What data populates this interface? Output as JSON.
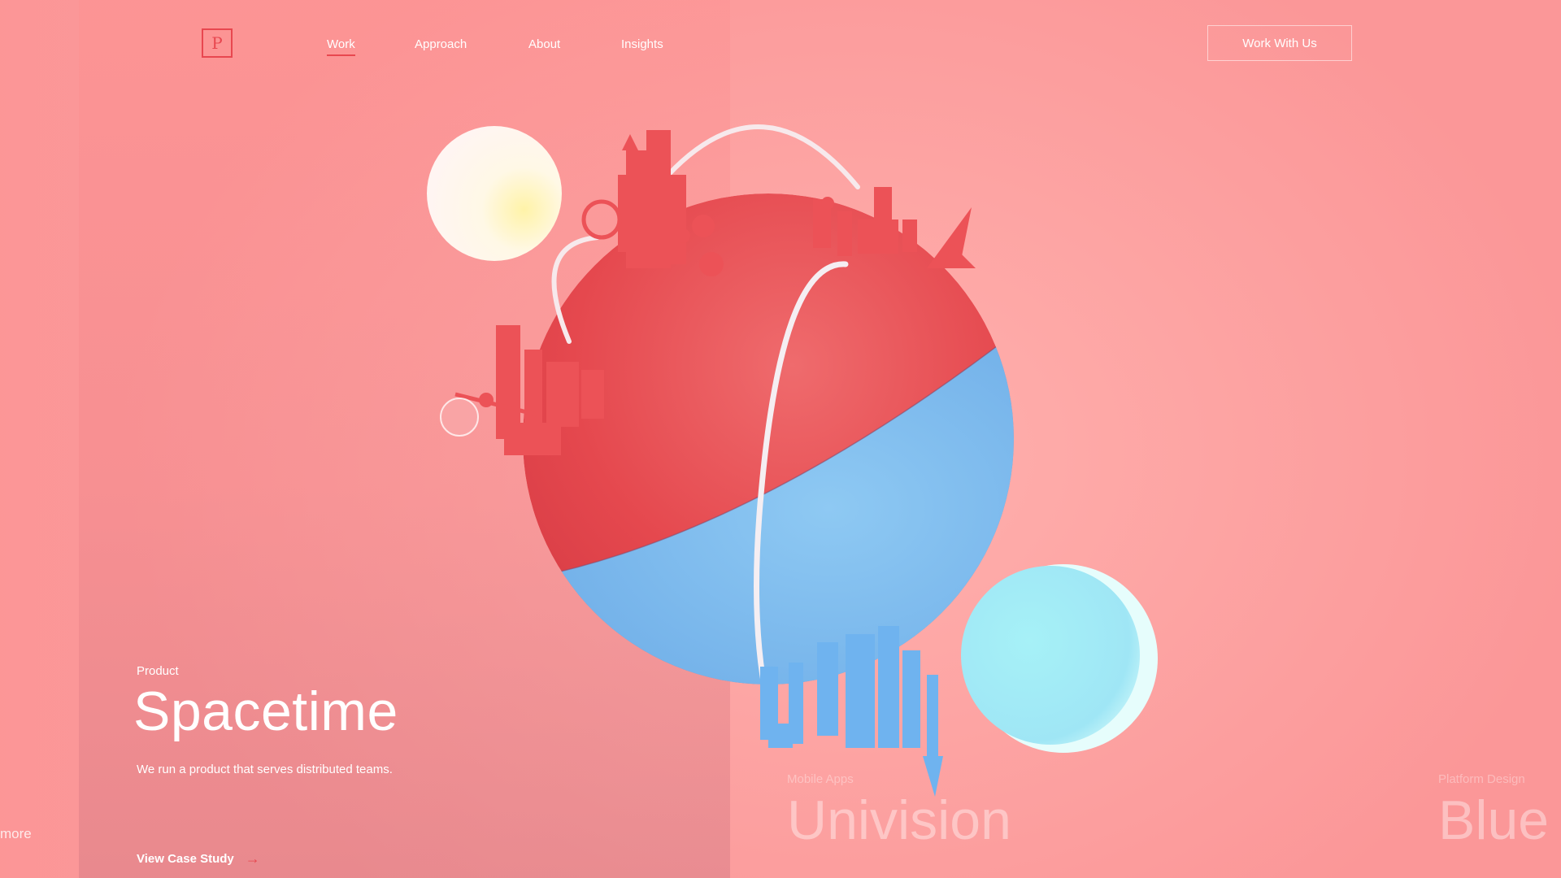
{
  "header": {
    "logo_letter": "P",
    "nav": [
      {
        "label": "Work",
        "active": true
      },
      {
        "label": "Approach",
        "active": false
      },
      {
        "label": "About",
        "active": false
      },
      {
        "label": "Insights",
        "active": false
      }
    ],
    "cta_label": "Work With Us"
  },
  "current_project": {
    "category": "Product",
    "title": "Spacetime",
    "description": "We run a product that serves distributed teams.",
    "link_label": "View Case Study",
    "link_icon": "arrow-right-icon"
  },
  "more_label": "more",
  "next_projects": [
    {
      "category": "Mobile Apps",
      "title": "Univision"
    },
    {
      "category": "Platform Design",
      "title": "Blue"
    }
  ],
  "colors": {
    "accent": "#e8474f",
    "background": "#fda1a1",
    "globe_red": "#ea5559",
    "globe_blue": "#8dc2ee"
  }
}
